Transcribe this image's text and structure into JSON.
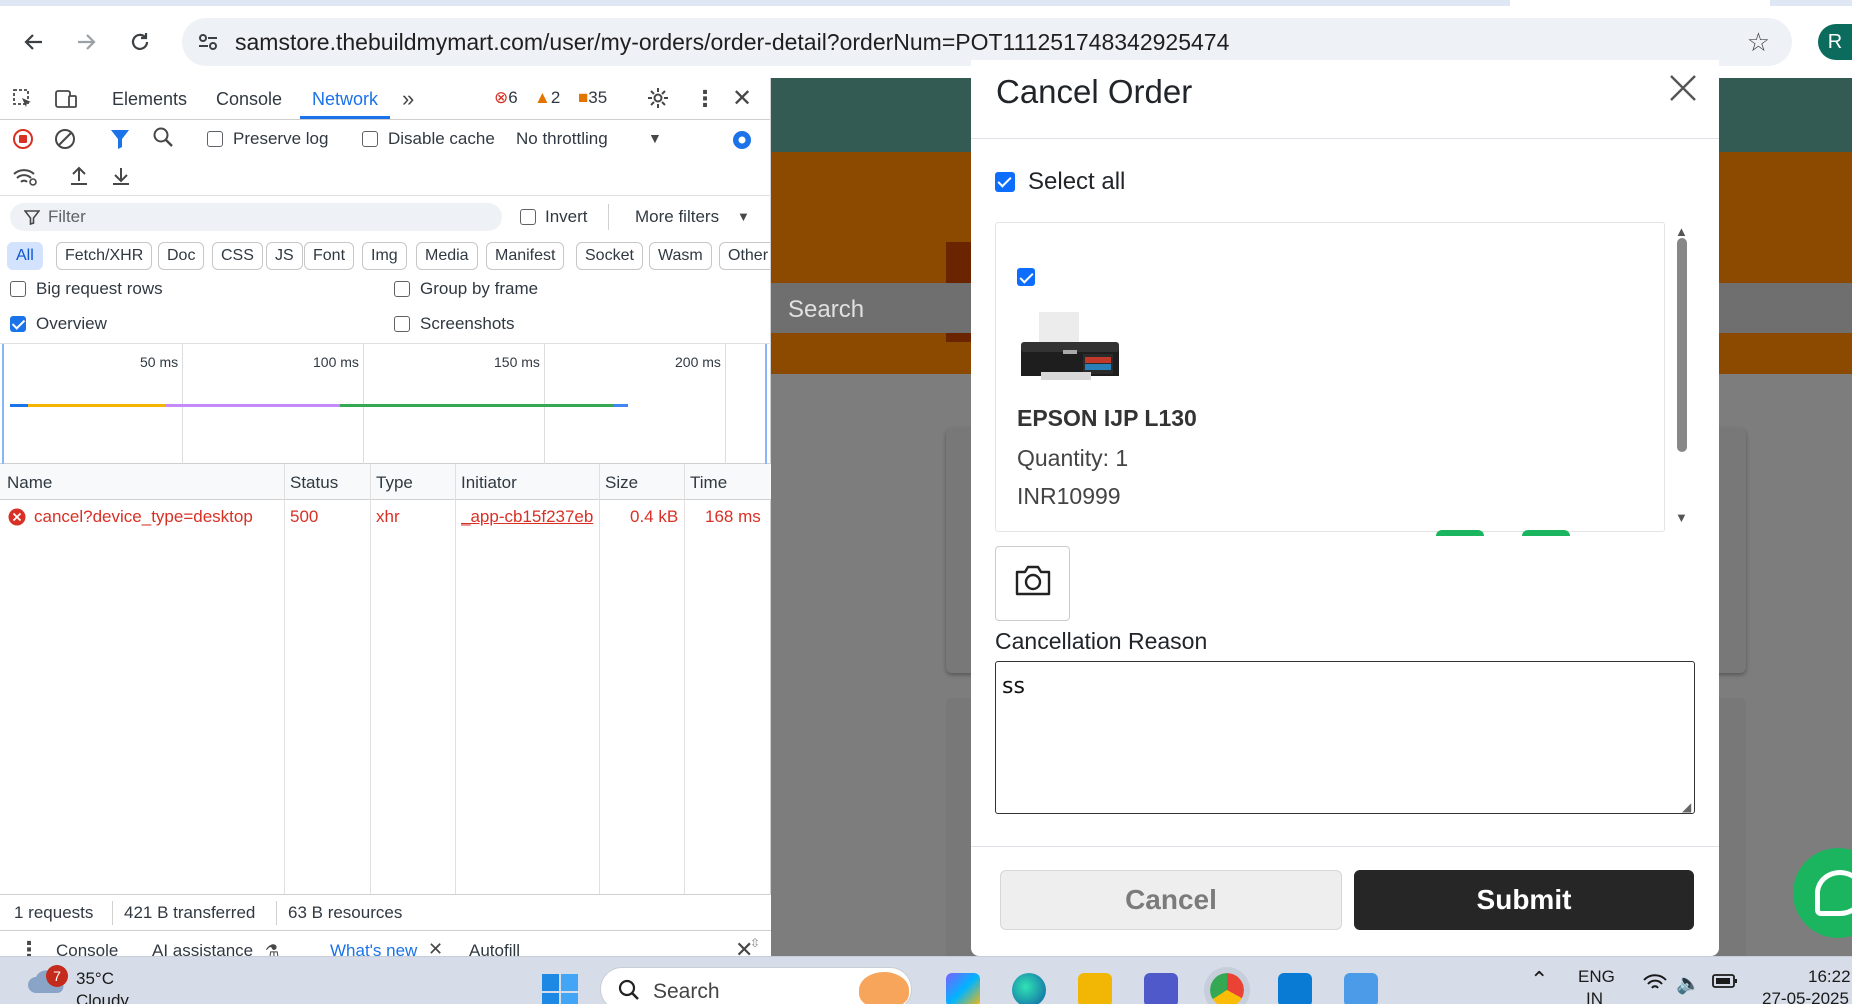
{
  "browser": {
    "url": "samstore.thebuildmymart.com/user/my-orders/order-detail?orderNum=POT111251748342925474",
    "profile_initial": "R"
  },
  "devtools": {
    "tabs": [
      "Elements",
      "Console",
      "Network"
    ],
    "active_tab": "Network",
    "counts": {
      "errors": "6",
      "warnings": "2",
      "issues": "35"
    },
    "toolbar": {
      "preserve_log": "Preserve log",
      "disable_cache": "Disable cache",
      "throttling": "No throttling"
    },
    "filter": {
      "placeholder": "Filter",
      "invert": "Invert",
      "more_filters": "More filters"
    },
    "type_chips": [
      "All",
      "Fetch/XHR",
      "Doc",
      "CSS",
      "JS",
      "Font",
      "Img",
      "Media",
      "Manifest",
      "Socket",
      "Wasm",
      "Other"
    ],
    "options": {
      "big_rows": "Big request rows",
      "group_by_frame": "Group by frame",
      "overview": "Overview",
      "screenshots": "Screenshots"
    },
    "timeline_ticks": [
      "50 ms",
      "100 ms",
      "150 ms",
      "200 ms"
    ],
    "table": {
      "headers": [
        "Name",
        "Status",
        "Type",
        "Initiator",
        "Size",
        "Time"
      ],
      "rows": [
        {
          "name": "cancel?device_type=desktop",
          "status": "500",
          "type": "xhr",
          "initiator": "_app-cb15f237eb",
          "size": "0.4 kB",
          "time": "168 ms"
        }
      ]
    },
    "summary": {
      "requests": "1 requests",
      "transferred": "421 B transferred",
      "resources": "63 B resources"
    },
    "drawer_tabs": {
      "console": "Console",
      "ai": "AI assistance",
      "whats_new": "What's new",
      "autofill": "Autofill"
    }
  },
  "page": {
    "search_placeholder": "Search"
  },
  "modal": {
    "title": "Cancel Order",
    "select_all": "Select all",
    "item": {
      "name": "EPSON IJP L130",
      "quantity": "Quantity: 1",
      "price": "INR10999"
    },
    "reason_label": "Cancellation Reason",
    "reason_value": "ss",
    "cancel_label": "Cancel",
    "submit_label": "Submit"
  },
  "taskbar": {
    "weather_badge": "7",
    "temperature": "35°C",
    "condition": "Cloudy",
    "search_placeholder": "Search",
    "lang_top": "ENG",
    "lang_bottom": "IN",
    "time": "16:22",
    "date": "27-05-2025"
  },
  "colors": {
    "devtools_accent": "#1a73e8",
    "error_red": "#d93025",
    "submit_dark": "#262626",
    "checkbox_blue": "#0d6efd"
  }
}
